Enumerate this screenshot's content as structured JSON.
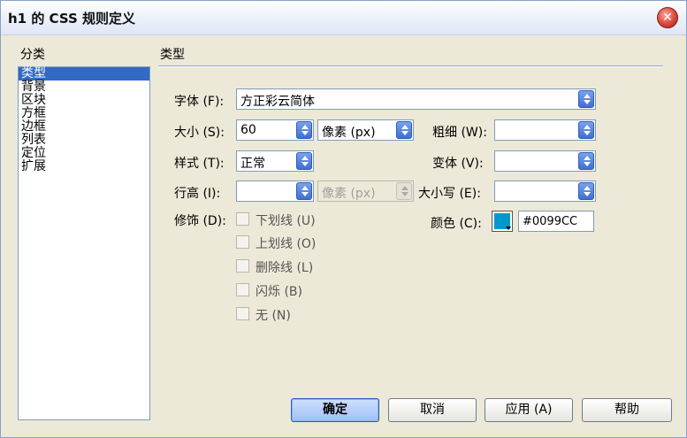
{
  "window": {
    "title": "h1 的 CSS 规则定义",
    "close_icon": "✕"
  },
  "category": {
    "heading": "分类",
    "items": [
      "类型",
      "背景",
      "区块",
      "方框",
      "边框",
      "列表",
      "定位",
      "扩展"
    ],
    "selected_index": 0
  },
  "section_title": "类型",
  "fields": {
    "font": {
      "label": "字体 (F):",
      "value": "方正彩云简体"
    },
    "size": {
      "label": "大小 (S):",
      "value": "60",
      "unit": "像素 (px)"
    },
    "weight": {
      "label": "粗细 (W):",
      "value": ""
    },
    "style": {
      "label": "样式 (T):",
      "value": "正常"
    },
    "variant": {
      "label": "变体 (V):",
      "value": ""
    },
    "line_height": {
      "label": "行高 (I):",
      "value": "",
      "unit": "像素 (px)"
    },
    "case": {
      "label": "大小写 (E):",
      "value": ""
    },
    "decoration": {
      "label": "修饰 (D):",
      "options": [
        "下划线 (U)",
        "上划线 (O)",
        "删除线 (L)",
        "闪烁 (B)",
        "无 (N)"
      ]
    },
    "color": {
      "label": "颜色 (C):",
      "value": "#0099CC",
      "swatch": "#0099CC"
    }
  },
  "buttons": {
    "ok": "确定",
    "cancel": "取消",
    "apply": "应用 (A)",
    "help": "帮助"
  }
}
